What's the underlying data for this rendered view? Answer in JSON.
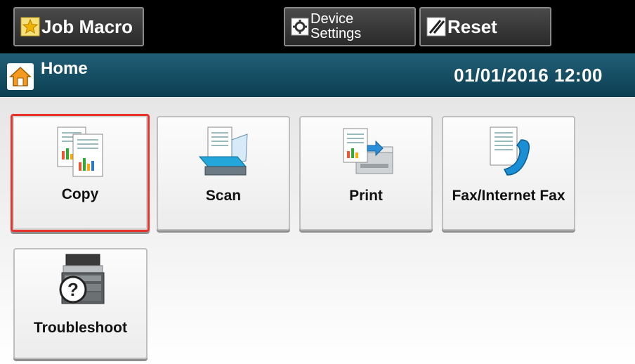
{
  "topbar": {
    "job_macro_label": "Job Macro",
    "device_settings_label": "Device\nSettings",
    "reset_label": "Reset"
  },
  "header": {
    "title": "Home",
    "datetime": "01/01/2016 12:00"
  },
  "tiles": [
    {
      "label": "Copy",
      "icon": "copy-icon",
      "selected": true
    },
    {
      "label": "Scan",
      "icon": "scan-icon",
      "selected": false
    },
    {
      "label": "Print",
      "icon": "print-icon",
      "selected": false
    },
    {
      "label": "Fax/Internet Fax",
      "icon": "fax-icon",
      "selected": false
    },
    {
      "label": "Troubleshoot",
      "icon": "troubleshoot-icon",
      "selected": false
    }
  ],
  "colors": {
    "header_bg": "#1f5f76",
    "selection_border": "#e8322b",
    "topbar_bg": "#000000"
  }
}
